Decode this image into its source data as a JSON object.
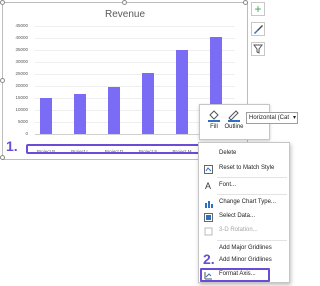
{
  "chart": {
    "title": "Revenue",
    "y_ticks": [
      "45000",
      "40000",
      "35000",
      "30000",
      "25000",
      "20000",
      "15000",
      "10000",
      "5000",
      "0"
    ],
    "x_labels": [
      "Project B",
      "Project L",
      "Project D",
      "Project S",
      "Project M"
    ]
  },
  "chart_data": {
    "type": "bar",
    "title": "Revenue",
    "categories": [
      "Project B",
      "Project L",
      "Project D",
      "Project S",
      "Project M",
      "Project ?"
    ],
    "values": [
      15000,
      16500,
      19500,
      25500,
      35000,
      40500
    ],
    "ylim": [
      0,
      45000
    ],
    "color": "#7b6cf6"
  },
  "steps": {
    "one": "1.",
    "two": "2."
  },
  "mini_toolbar": {
    "fill_label": "Fill",
    "outline_label": "Outline",
    "element_select": "Horizontal (Cat"
  },
  "menu": {
    "delete": "Delete",
    "reset": "Reset to Match Style",
    "font": "Font...",
    "change_type": "Change Chart Type...",
    "select_data": "Select Data...",
    "rotation": "3-D Rotation...",
    "add_major": "Add Major Gridlines",
    "add_minor": "Add Minor Gridlines",
    "format_axis": "Format Axis..."
  },
  "colors": {
    "bar": "#7b6cf6",
    "highlight": "#6a4cd6",
    "chart_elements_icon": "#3fa34d"
  }
}
